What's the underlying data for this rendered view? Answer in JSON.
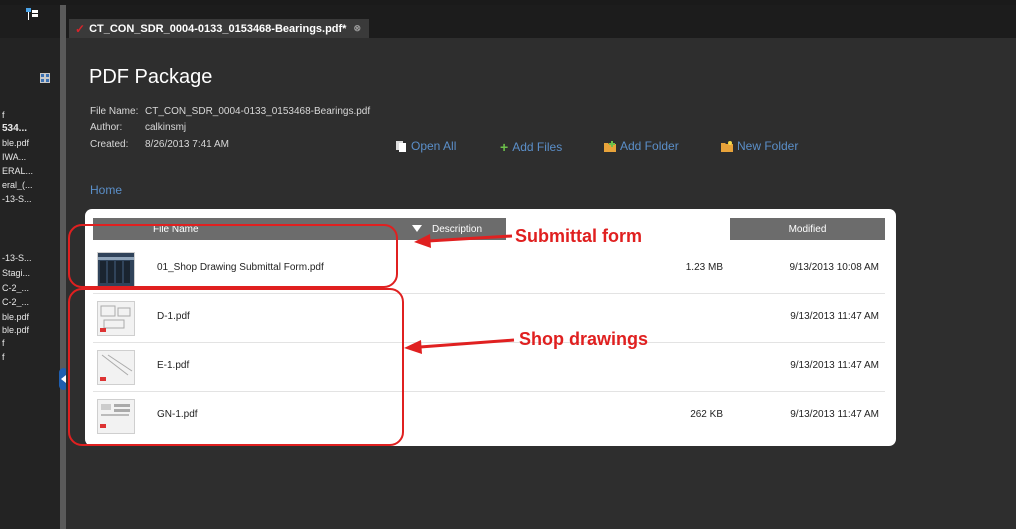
{
  "tab": {
    "title": "CT_CON_SDR_0004-0133_0153468-Bearings.pdf*"
  },
  "sidebar": {
    "items": [
      {
        "label": "f",
        "bold": false
      },
      {
        "label": "534...",
        "bold": true
      },
      {
        "label": "ble.pdf",
        "bold": false
      },
      {
        "label": "IWA...",
        "bold": false
      },
      {
        "label": "ERAL...",
        "bold": false
      },
      {
        "label": "eral_(...",
        "bold": false
      },
      {
        "label": "-13-S...",
        "bold": false
      },
      {
        "label": "-13-S...",
        "bold": false
      },
      {
        "label": "Stagi...",
        "bold": false
      },
      {
        "label": "C-2_...",
        "bold": false
      },
      {
        "label": "C-2_...",
        "bold": false
      },
      {
        "label": "ble.pdf",
        "bold": false
      },
      {
        "label": "ble.pdf",
        "bold": false
      },
      {
        "label": "f",
        "bold": false
      },
      {
        "label": "f",
        "bold": false
      }
    ]
  },
  "package": {
    "heading": "PDF Package",
    "file_name_label": "File Name:",
    "file_name": "CT_CON_SDR_0004-0133_0153468-Bearings.pdf",
    "author_label": "Author:",
    "author": "calkinsmj",
    "created_label": "Created:",
    "created": "8/26/2013 7:41 AM"
  },
  "toolbar": {
    "open_all": "Open All",
    "add_files": "Add Files",
    "add_folder": "Add Folder",
    "new_folder": "New Folder"
  },
  "breadcrumb": {
    "home": "Home"
  },
  "table": {
    "headers": {
      "file_name": "File Name",
      "description": "Description",
      "modified": "Modified"
    },
    "rows": [
      {
        "name": "01_Shop Drawing Submittal Form.pdf",
        "size": "1.23 MB",
        "modified": "9/13/2013 10:08 AM"
      },
      {
        "name": "D-1.pdf",
        "size": "",
        "modified": "9/13/2013 11:47 AM"
      },
      {
        "name": "E-1.pdf",
        "size": "",
        "modified": "9/13/2013 11:47 AM"
      },
      {
        "name": "GN-1.pdf",
        "size": "262 KB",
        "modified": "9/13/2013 11:47 AM"
      }
    ]
  },
  "annotations": {
    "submittal": "Submittal form",
    "shop": "Shop drawings",
    "color": "#e02020"
  }
}
